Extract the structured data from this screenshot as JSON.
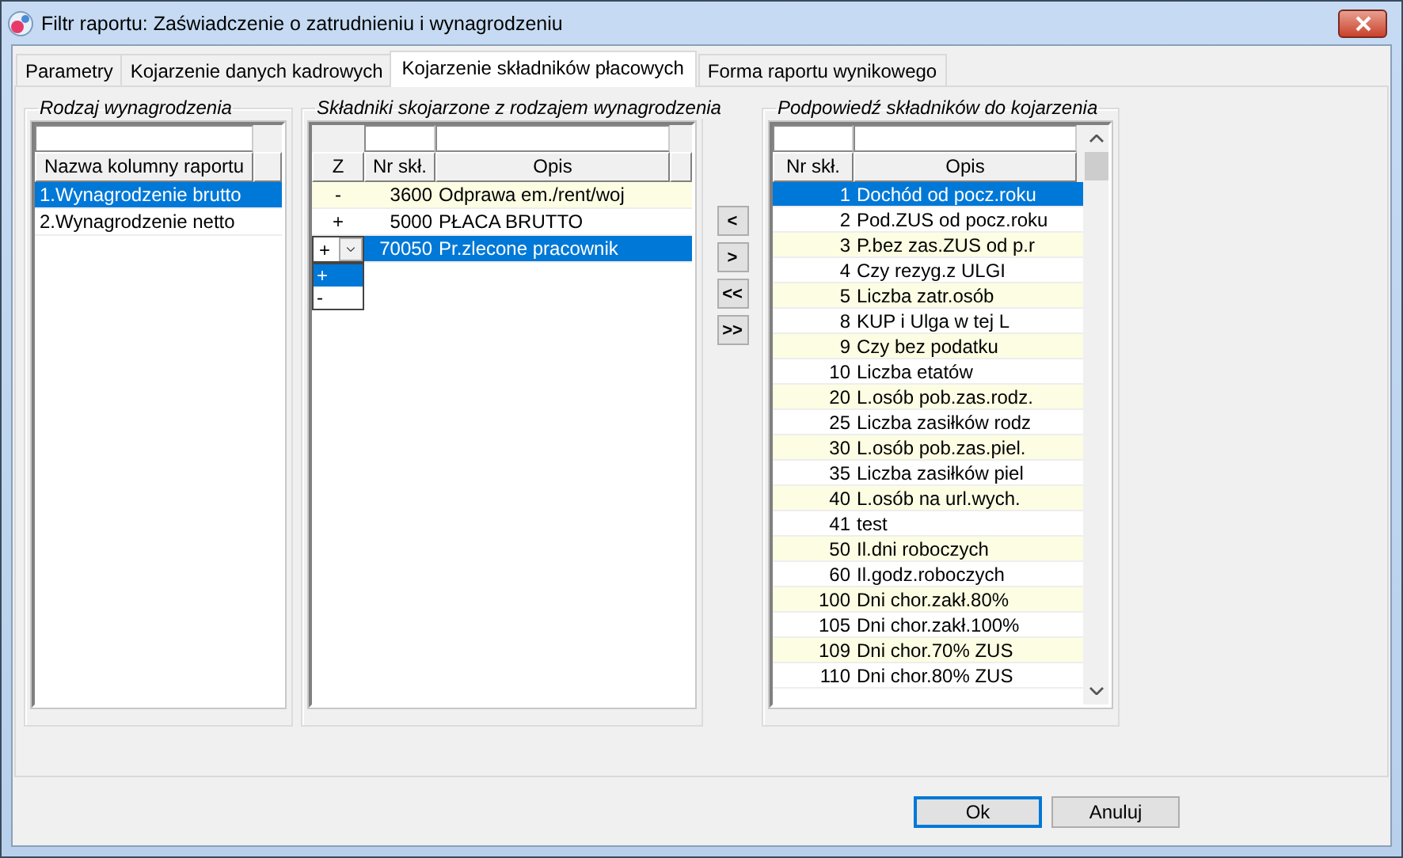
{
  "window": {
    "title": "Filtr raportu: Zaświadczenie o zatrudnieniu i wynagrodzeniu"
  },
  "tabs": [
    {
      "label": "Parametry",
      "selected": false
    },
    {
      "label": "Kojarzenie danych kadrowych",
      "selected": false
    },
    {
      "label": "Kojarzenie składników płacowych",
      "selected": true
    },
    {
      "label": "Forma raportu wynikowego",
      "selected": false
    }
  ],
  "left_group": {
    "title": "Rodzaj wynagrodzenia",
    "columns": [
      "Nazwa kolumny raportu"
    ],
    "rows": [
      {
        "text": "1.Wynagrodzenie brutto",
        "selected": true
      },
      {
        "text": "2.Wynagrodzenie netto",
        "selected": false
      }
    ]
  },
  "middle_group": {
    "title": "Składniki skojarzone z rodzajem wynagrodzenia",
    "columns": [
      "Z",
      "Nr skł.",
      "Opis"
    ],
    "rows": [
      {
        "z": "-",
        "nr": "3600",
        "opis": "Odprawa em./rent/woj",
        "selected": false,
        "editing": false
      },
      {
        "z": "+",
        "nr": "5000",
        "opis": "PŁACA BRUTTO",
        "selected": false,
        "editing": false
      },
      {
        "z": "+",
        "nr": "70050",
        "opis": "Pr.zlecone pracownik",
        "selected": true,
        "editing": true
      }
    ],
    "editor_options": [
      {
        "label": "+",
        "selected": true
      },
      {
        "label": "-",
        "selected": false
      }
    ]
  },
  "move_buttons": [
    "<",
    ">",
    "<<",
    ">>"
  ],
  "right_group": {
    "title": "Podpowiedź składników do kojarzenia",
    "columns": [
      "Nr skł.",
      "Opis"
    ],
    "rows": [
      {
        "nr": "1",
        "opis": "Dochód od pocz.roku",
        "selected": true
      },
      {
        "nr": "2",
        "opis": "Pod.ZUS od pocz.roku",
        "selected": false
      },
      {
        "nr": "3",
        "opis": "P.bez zas.ZUS od p.r",
        "selected": false
      },
      {
        "nr": "4",
        "opis": "Czy rezyg.z ULGI",
        "selected": false
      },
      {
        "nr": "5",
        "opis": "Liczba zatr.osób",
        "selected": false
      },
      {
        "nr": "8",
        "opis": "KUP i Ulga w tej L",
        "selected": false
      },
      {
        "nr": "9",
        "opis": "Czy bez podatku",
        "selected": false
      },
      {
        "nr": "10",
        "opis": "Liczba etatów",
        "selected": false
      },
      {
        "nr": "20",
        "opis": "L.osób pob.zas.rodz.",
        "selected": false
      },
      {
        "nr": "25",
        "opis": "Liczba zasiłków rodz",
        "selected": false
      },
      {
        "nr": "30",
        "opis": "L.osób pob.zas.piel.",
        "selected": false
      },
      {
        "nr": "35",
        "opis": "Liczba zasiłków piel",
        "selected": false
      },
      {
        "nr": "40",
        "opis": "L.osób na url.wych.",
        "selected": false
      },
      {
        "nr": "41",
        "opis": "test",
        "selected": false
      },
      {
        "nr": "50",
        "opis": "Il.dni roboczych",
        "selected": false
      },
      {
        "nr": "60",
        "opis": "Il.godz.roboczych",
        "selected": false
      },
      {
        "nr": "100",
        "opis": "Dni chor.zakł.80%",
        "selected": false
      },
      {
        "nr": "105",
        "opis": "Dni chor.zakł.100%",
        "selected": false
      },
      {
        "nr": "109",
        "opis": "Dni chor.70% ZUS",
        "selected": false
      },
      {
        "nr": "110",
        "opis": "Dni chor.80% ZUS",
        "selected": false
      }
    ]
  },
  "buttons": [
    {
      "label": "Ok",
      "default": true
    },
    {
      "label": "Anuluj",
      "default": false
    }
  ]
}
